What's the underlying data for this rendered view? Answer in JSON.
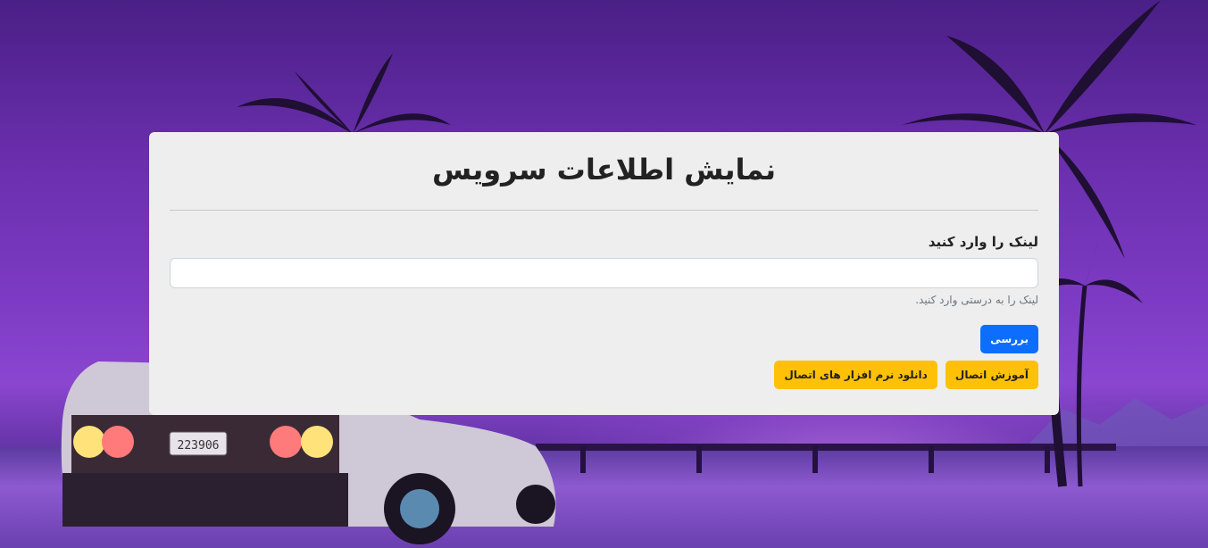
{
  "page": {
    "title": "نمایش اطلاعات سرویس"
  },
  "form": {
    "link_label": "لینک را وارد کنید",
    "link_value": "",
    "link_placeholder": "",
    "hint": "لینک را به درستی وارد کنید.",
    "submit_label": "بررسی"
  },
  "actions": {
    "tutorial_label": "آموزش اتصال",
    "download_label": "دانلود نرم افزار های اتصال"
  },
  "background": {
    "plate_text": "223906"
  },
  "colors": {
    "primary": "#0d6efd",
    "warning": "#ffc107",
    "card": "#eeeeee"
  }
}
